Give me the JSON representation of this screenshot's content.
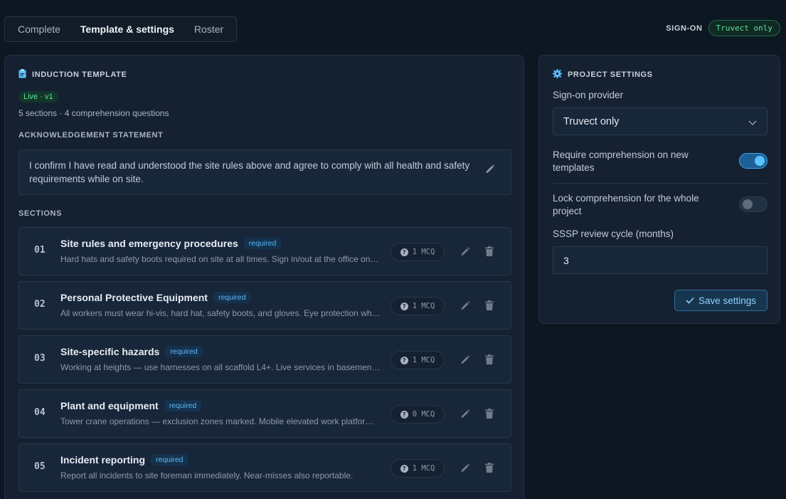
{
  "tabs": [
    {
      "label": "Complete"
    },
    {
      "label": "Template & settings"
    },
    {
      "label": "Roster"
    }
  ],
  "signon": {
    "label": "SIGN-ON",
    "badge": "Truvect only"
  },
  "template": {
    "title": "INDUCTION TEMPLATE",
    "live_badge": "Live · v1",
    "meta": "5 sections · 4 comprehension questions",
    "ack_label": "ACKNOWLEDGEMENT STATEMENT",
    "ack_text": "I confirm I have read and understood the site rules above and agree to comply with all health and safety requirements while on site.",
    "sections_label": "SECTIONS",
    "sections": [
      {
        "num": "01",
        "title": "Site rules and emergency procedures",
        "badge": "required",
        "desc": "Hard hats and safety boots required on site at all times. Sign in/out at the office on arrival and departure.",
        "mcq": "1 MCQ"
      },
      {
        "num": "02",
        "title": "Personal Protective Equipment",
        "badge": "required",
        "desc": "All workers must wear hi-vis, hard hat, safety boots, and gloves. Eye protection where required.",
        "mcq": "1 MCQ"
      },
      {
        "num": "03",
        "title": "Site-specific hazards",
        "badge": "required",
        "desc": "Working at heights — use harnesses on all scaffold L4+. Live services in basement level.",
        "mcq": "1 MCQ"
      },
      {
        "num": "04",
        "title": "Plant and equipment",
        "badge": "required",
        "desc": "Tower crane operations — exclusion zones marked. Mobile elevated work platforms require ticket.",
        "mcq": "0 MCQ"
      },
      {
        "num": "05",
        "title": "Incident reporting",
        "badge": "required",
        "desc": "Report all incidents to site foreman immediately. Near-misses also reportable.",
        "mcq": "1 MCQ"
      }
    ]
  },
  "settings": {
    "title": "PROJECT SETTINGS",
    "provider_label": "Sign-on provider",
    "provider_value": "Truvect only",
    "require_label": "Require comprehension on new templates",
    "require_on": true,
    "lock_label": "Lock comprehension for the whole project",
    "lock_on": false,
    "sssp_label": "SSSP review cycle (months)",
    "sssp_value": "3",
    "save_label": "Save settings"
  },
  "colors": {
    "accent": "#3aa8f0",
    "success": "#5fe0a0",
    "background": "#0d1722",
    "panel": "#152131"
  }
}
